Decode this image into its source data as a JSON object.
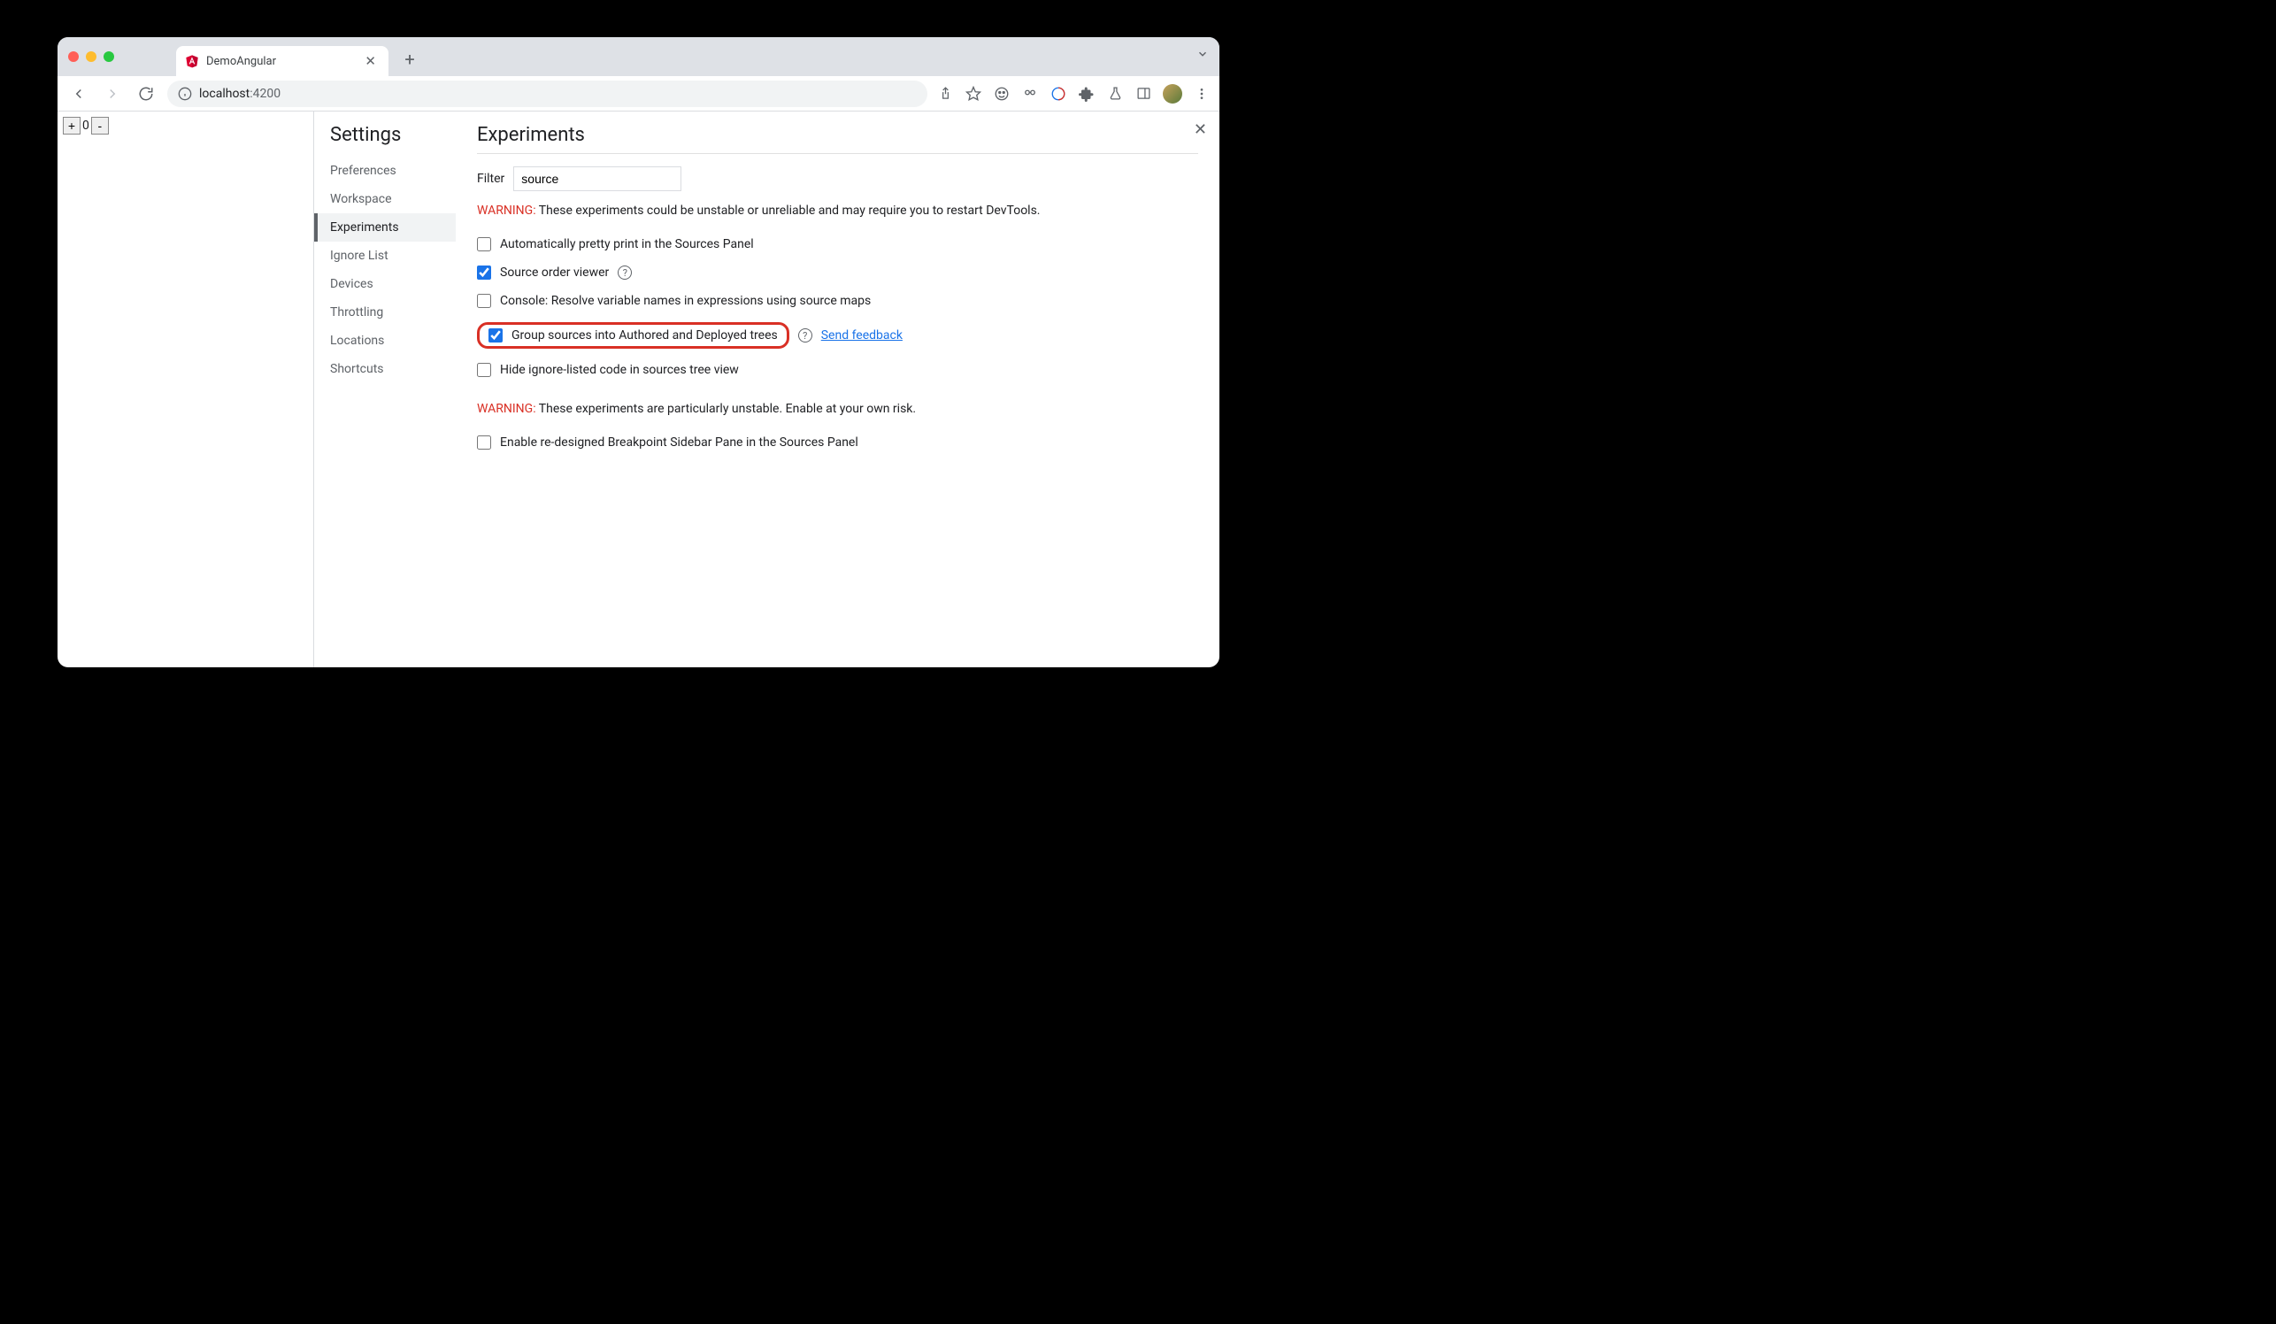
{
  "tab": {
    "title": "DemoAngular"
  },
  "url": {
    "host": "localhost",
    "port": ":4200"
  },
  "page": {
    "counter_value": "0",
    "plus": "+",
    "minus": "-"
  },
  "settings": {
    "title": "Settings",
    "items": [
      "Preferences",
      "Workspace",
      "Experiments",
      "Ignore List",
      "Devices",
      "Throttling",
      "Locations",
      "Shortcuts"
    ],
    "active_index": 2
  },
  "experiments": {
    "title": "Experiments",
    "filter_label": "Filter",
    "filter_value": "source",
    "warning1_label": "WARNING:",
    "warning1_text": " These experiments could be unstable or unreliable and may require you to restart DevTools.",
    "items": [
      {
        "label": "Automatically pretty print in the Sources Panel",
        "checked": false,
        "help": false
      },
      {
        "label": "Source order viewer",
        "checked": true,
        "help": true
      },
      {
        "label": "Console: Resolve variable names in expressions using source maps",
        "checked": false,
        "help": false
      },
      {
        "label": "Group sources into Authored and Deployed trees",
        "checked": true,
        "help": true,
        "highlight": true,
        "feedback": "Send feedback"
      },
      {
        "label": "Hide ignore-listed code in sources tree view",
        "checked": false,
        "help": false
      }
    ],
    "warning2_label": "WARNING:",
    "warning2_text": " These experiments are particularly unstable. Enable at your own risk.",
    "unstable_items": [
      {
        "label": "Enable re-designed Breakpoint Sidebar Pane in the Sources Panel",
        "checked": false
      }
    ]
  }
}
